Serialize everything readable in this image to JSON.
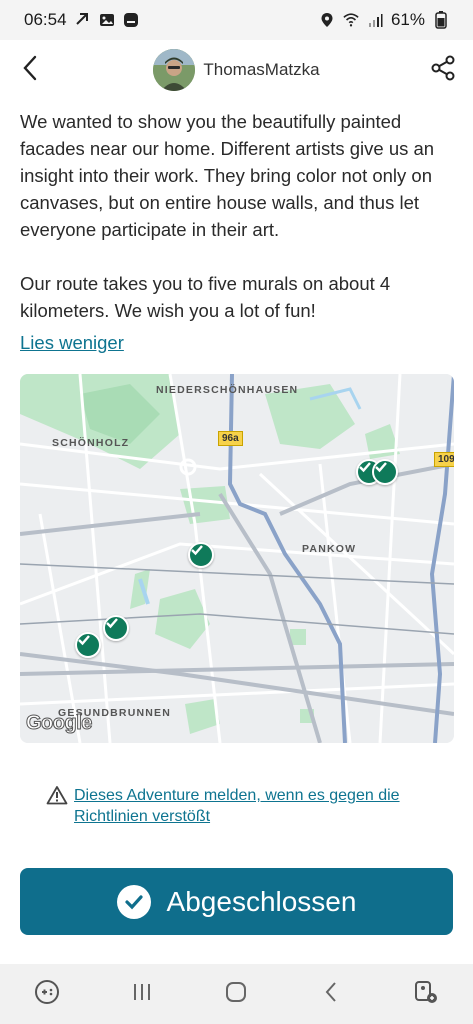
{
  "status_bar": {
    "time": "06:54",
    "battery": "61%"
  },
  "header": {
    "username": "ThomasMatzka"
  },
  "description": {
    "paragraph_1": "We wanted to show you the beautifully painted facades near our home. Different artists give us an insight into their work. They bring color not only on canvases, but on entire house walls, and thus let everyone participate in their art.",
    "paragraph_2": "Our route takes you to five murals on about 4 kilometers. We wish you a lot of fun!",
    "less_link": "Lies weniger"
  },
  "map": {
    "labels": {
      "niederschoenhausen": "NIEDERSCHÖNHAUSEN",
      "schoenholz": "SCHÖNHOLZ",
      "pankow": "PANKOW",
      "gesundbrunnen": "GESUNDBRUNNEN"
    },
    "road_shields": {
      "r96a": "96a",
      "r109": "109"
    },
    "google": "Google",
    "pins_count": 5
  },
  "report": {
    "text": "Dieses Adventure melden, wenn es gegen die Richtlinien verstößt"
  },
  "completed_button": {
    "label": "Abgeschlossen"
  },
  "colors": {
    "accent": "#0f6e8c",
    "link": "#0e7490",
    "pin": "#0f7a5a"
  }
}
